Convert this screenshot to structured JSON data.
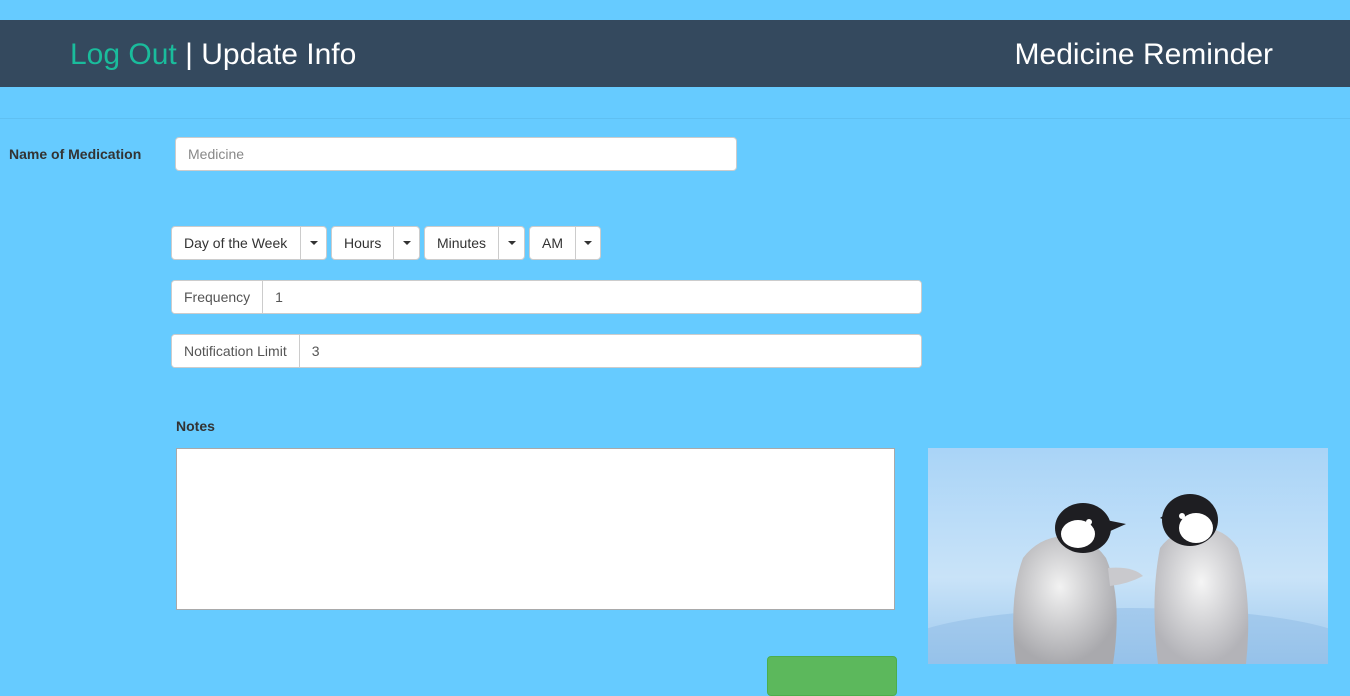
{
  "navbar": {
    "logout": "Log Out",
    "separator": " | ",
    "update_info": "Update Info",
    "title": "Medicine Reminder"
  },
  "medication": {
    "label": "Name of Medication",
    "placeholder": "Medicine",
    "value": ""
  },
  "schedule": {
    "day": "Day of the Week",
    "hours": "Hours",
    "minutes": "Minutes",
    "ampm": "AM"
  },
  "frequency": {
    "label": "Frequency",
    "value": "1"
  },
  "notification_limit": {
    "label": "Notification Limit",
    "value": "3"
  },
  "notes": {
    "label": "Notes",
    "value": ""
  },
  "image": {
    "alt": "two baby penguins",
    "icon": "penguins-photo"
  },
  "colors": {
    "background": "#66cbff",
    "navbar": "#34495e",
    "logout_link": "#1abc9c",
    "submit": "#5cb85c"
  }
}
